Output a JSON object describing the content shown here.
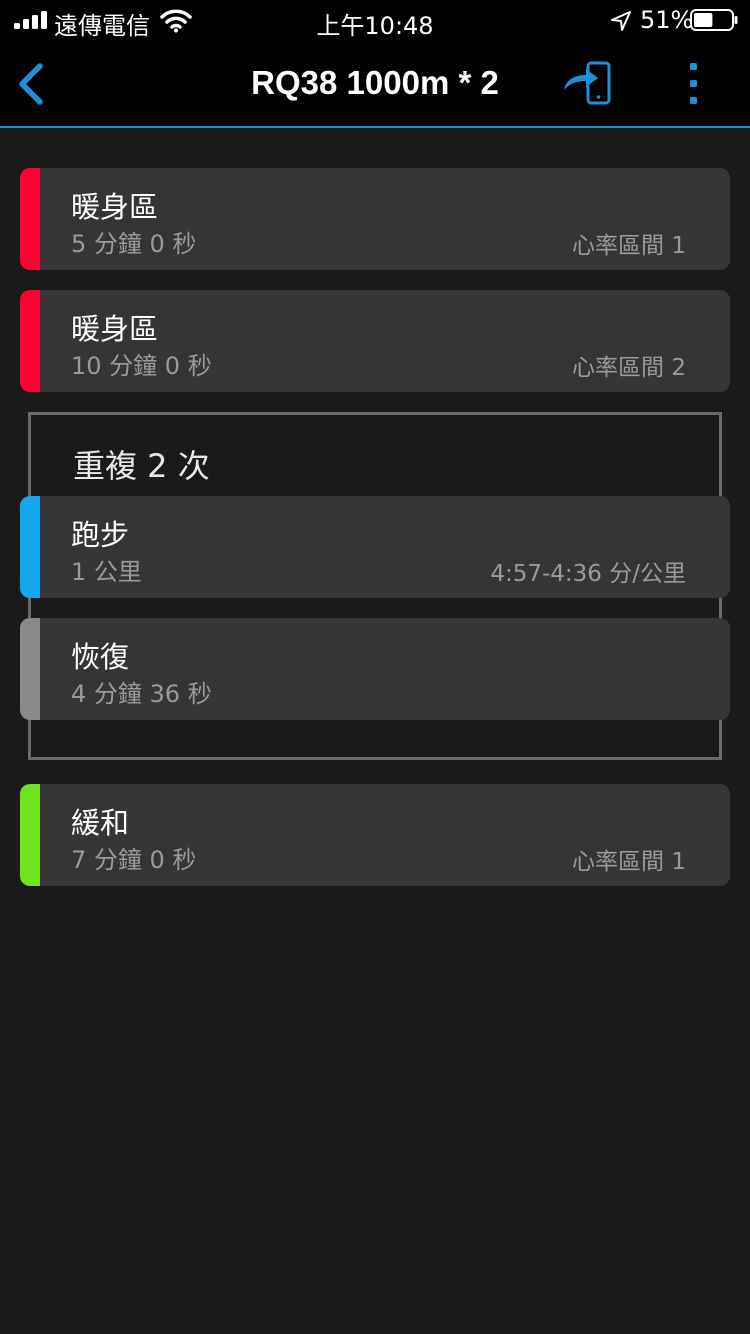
{
  "status_bar": {
    "carrier": "遠傳電信",
    "time": "上午10:48",
    "battery_percent": "51%",
    "battery_level": 0.51
  },
  "nav": {
    "title": "RQ38 1000m * 2",
    "accent_color": "#1e90d8"
  },
  "steps": [
    {
      "name": "暖身區",
      "duration": "5 分鐘 0 秒",
      "target": "心率區間 1",
      "color": "#ff0033"
    },
    {
      "name": "暖身區",
      "duration": "10 分鐘 0 秒",
      "target": "心率區間 2",
      "color": "#ff0033"
    }
  ],
  "repeat": {
    "title": "重複 2 次",
    "steps": [
      {
        "name": "跑步",
        "duration": "1 公里",
        "target": "4:57-4:36 分/公里",
        "color": "#13a7f0"
      },
      {
        "name": "恢復",
        "duration": "4 分鐘 36 秒",
        "target": "",
        "color": "#8a8a8a"
      }
    ]
  },
  "cooldown": {
    "name": "緩和",
    "duration": "7 分鐘 0 秒",
    "target": "心率區間 1",
    "color": "#6fe51e"
  }
}
